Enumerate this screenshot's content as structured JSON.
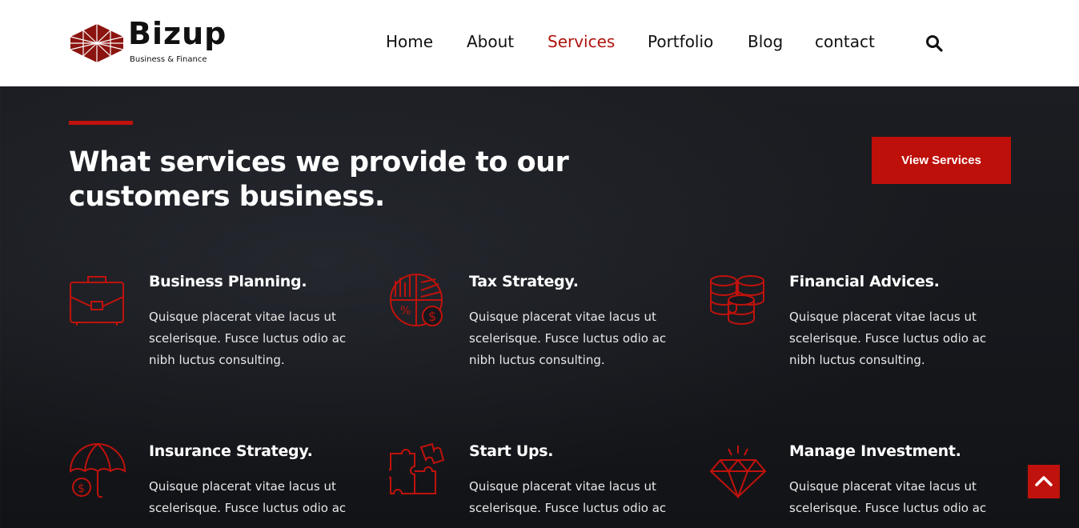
{
  "brand": {
    "name": "Bizup",
    "tagline": "Business & Finance",
    "accent_color": "#c0120c"
  },
  "nav": {
    "items": [
      {
        "label": "Home",
        "active": false
      },
      {
        "label": "About",
        "active": false
      },
      {
        "label": "Services",
        "active": true
      },
      {
        "label": "Portfolio",
        "active": false
      },
      {
        "label": "Blog",
        "active": false
      },
      {
        "label": "contact",
        "active": false
      }
    ],
    "search_icon": "search-icon"
  },
  "hero": {
    "heading_line1": "What services we provide to our",
    "heading_line2": "customers business.",
    "cta_label": "View Services"
  },
  "services": [
    {
      "title": "Business Planning.",
      "icon": "briefcase-icon",
      "text": "Quisque placerat vitae lacus ut scelerisque. Fusce luctus odio ac nibh luctus consulting."
    },
    {
      "title": "Tax Strategy.",
      "icon": "tax-chart-icon",
      "text": "Quisque placerat vitae lacus ut scelerisque. Fusce luctus odio ac nibh luctus consulting."
    },
    {
      "title": "Financial Advices.",
      "icon": "coins-icon",
      "text": "Quisque placerat vitae lacus ut scelerisque. Fusce luctus odio ac nibh luctus consulting."
    },
    {
      "title": "Insurance Strategy.",
      "icon": "umbrella-icon",
      "text": "Quisque placerat vitae lacus ut scelerisque. Fusce luctus odio ac"
    },
    {
      "title": "Start Ups.",
      "icon": "puzzle-icon",
      "text": "Quisque placerat vitae lacus ut scelerisque. Fusce luctus odio ac"
    },
    {
      "title": "Manage Investment.",
      "icon": "diamond-icon",
      "text": "Quisque placerat vitae lacus ut scelerisque. Fusce luctus odio ac"
    }
  ],
  "scroll_top_icon": "chevron-up-icon"
}
